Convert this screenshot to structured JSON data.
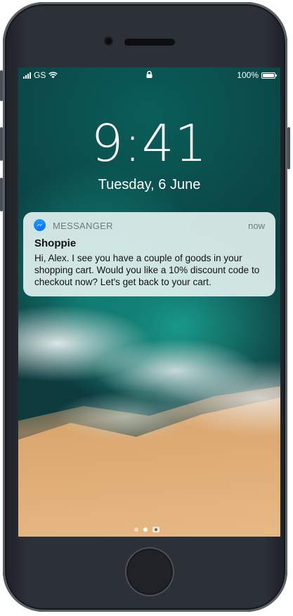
{
  "status_bar": {
    "carrier": "GS",
    "battery_percent": "100%",
    "battery_level": 1.0,
    "signal_icon": "cellular-signal-icon",
    "wifi_icon": "wifi-icon",
    "lock_icon": "lock-icon",
    "battery_icon": "battery-icon"
  },
  "lock_screen": {
    "time": "9:41",
    "date": "Tuesday, 6 June"
  },
  "notification": {
    "app_name": "MESSANGER",
    "app_icon": "messenger-icon",
    "time": "now",
    "title": "Shoppie",
    "body": "Hi, Alex. I see you have a couple of goods in your shopping cart. Would you like a 10% discount code to checkout now? Let's get back to your cart."
  },
  "page_indicator": {
    "pages": 2,
    "active": 1,
    "camera_icon": "camera-icon"
  },
  "colors": {
    "notification_bg": "#e1f0ee",
    "messenger_blue": "#0a84ff",
    "water": "#0c4a48",
    "sand": "#e0ad76"
  }
}
